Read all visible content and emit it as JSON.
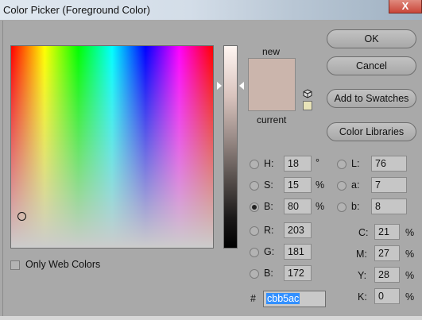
{
  "window": {
    "title": "Color Picker (Foreground Color)",
    "close_glyph": "X"
  },
  "buttons": {
    "ok": "OK",
    "cancel": "Cancel",
    "add_to_swatches": "Add to Swatches",
    "color_libraries": "Color Libraries"
  },
  "preview": {
    "new_label": "new",
    "current_label": "current",
    "color": "#cbb5ac"
  },
  "hsb": {
    "h": {
      "label": "H:",
      "value": "18",
      "unit": "°"
    },
    "s": {
      "label": "S:",
      "value": "15",
      "unit": "%"
    },
    "b": {
      "label": "B:",
      "value": "80",
      "unit": "%"
    }
  },
  "rgb": {
    "r": {
      "label": "R:",
      "value": "203"
    },
    "g": {
      "label": "G:",
      "value": "181"
    },
    "b": {
      "label": "B:",
      "value": "172"
    }
  },
  "lab": {
    "l": {
      "label": "L:",
      "value": "76"
    },
    "a": {
      "label": "a:",
      "value": "7"
    },
    "b": {
      "label": "b:",
      "value": "8"
    }
  },
  "cmyk": {
    "c": {
      "label": "C:",
      "value": "21",
      "unit": "%"
    },
    "m": {
      "label": "M:",
      "value": "27",
      "unit": "%"
    },
    "y": {
      "label": "Y:",
      "value": "28",
      "unit": "%"
    },
    "k": {
      "label": "K:",
      "value": "0",
      "unit": "%"
    }
  },
  "hex": {
    "label": "#",
    "value": "cbb5ac"
  },
  "only_web_colors": {
    "label": "Only Web Colors",
    "checked": false
  },
  "selected_mode": "B",
  "icons": {
    "cube": "cube-icon",
    "web_safe": "web-safe-color-chip"
  }
}
